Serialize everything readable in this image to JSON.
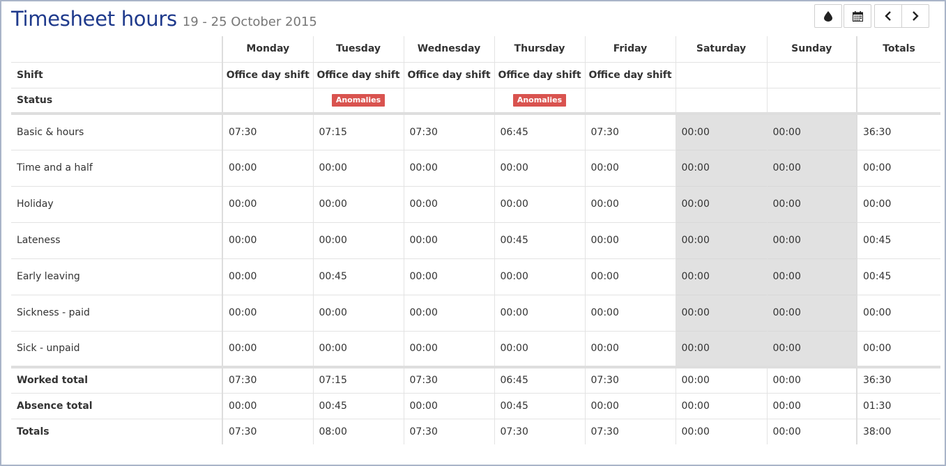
{
  "header": {
    "title": "Timesheet hours",
    "subtitle": "19 - 25 October 2015"
  },
  "toolbar": {
    "icons": [
      "drop-icon",
      "calendar-icon",
      "chevron-left-icon",
      "chevron-right-icon"
    ]
  },
  "columns": [
    "Monday",
    "Tuesday",
    "Wednesday",
    "Thursday",
    "Friday",
    "Saturday",
    "Sunday",
    "Totals"
  ],
  "shift": {
    "label": "Shift",
    "values": [
      "Office day shift",
      "Office day shift",
      "Office day shift",
      "Office day shift",
      "Office day shift",
      "",
      "",
      ""
    ]
  },
  "status": {
    "label": "Status",
    "values": [
      "",
      "Anomalies",
      "",
      "Anomalies",
      "",
      "",
      "",
      ""
    ]
  },
  "rows": [
    {
      "label": "Basic & hours",
      "values": [
        "07:30",
        "07:15",
        "07:30",
        "06:45",
        "07:30",
        "00:00",
        "00:00",
        "36:30"
      ]
    },
    {
      "label": "Time and a half",
      "values": [
        "00:00",
        "00:00",
        "00:00",
        "00:00",
        "00:00",
        "00:00",
        "00:00",
        "00:00"
      ]
    },
    {
      "label": "Holiday",
      "values": [
        "00:00",
        "00:00",
        "00:00",
        "00:00",
        "00:00",
        "00:00",
        "00:00",
        "00:00"
      ]
    },
    {
      "label": "Lateness",
      "values": [
        "00:00",
        "00:00",
        "00:00",
        "00:45",
        "00:00",
        "00:00",
        "00:00",
        "00:45"
      ]
    },
    {
      "label": "Early leaving",
      "values": [
        "00:00",
        "00:45",
        "00:00",
        "00:00",
        "00:00",
        "00:00",
        "00:00",
        "00:45"
      ]
    },
    {
      "label": "Sickness - paid",
      "values": [
        "00:00",
        "00:00",
        "00:00",
        "00:00",
        "00:00",
        "00:00",
        "00:00",
        "00:00"
      ]
    },
    {
      "label": "Sick - unpaid",
      "values": [
        "00:00",
        "00:00",
        "00:00",
        "00:00",
        "00:00",
        "00:00",
        "00:00",
        "00:00"
      ]
    }
  ],
  "totals": [
    {
      "label": "Worked total",
      "values": [
        "07:30",
        "07:15",
        "07:30",
        "06:45",
        "07:30",
        "00:00",
        "00:00",
        "36:30"
      ]
    },
    {
      "label": "Absence total",
      "values": [
        "00:00",
        "00:45",
        "00:00",
        "00:45",
        "00:00",
        "00:00",
        "00:00",
        "01:30"
      ]
    },
    {
      "label": "Totals",
      "values": [
        "07:30",
        "08:00",
        "07:30",
        "07:30",
        "07:30",
        "00:00",
        "00:00",
        "38:00"
      ]
    }
  ],
  "colors": {
    "title": "#1f3a8c",
    "badge": "#d9534f",
    "weekend_shade": "#e1e1e1"
  }
}
